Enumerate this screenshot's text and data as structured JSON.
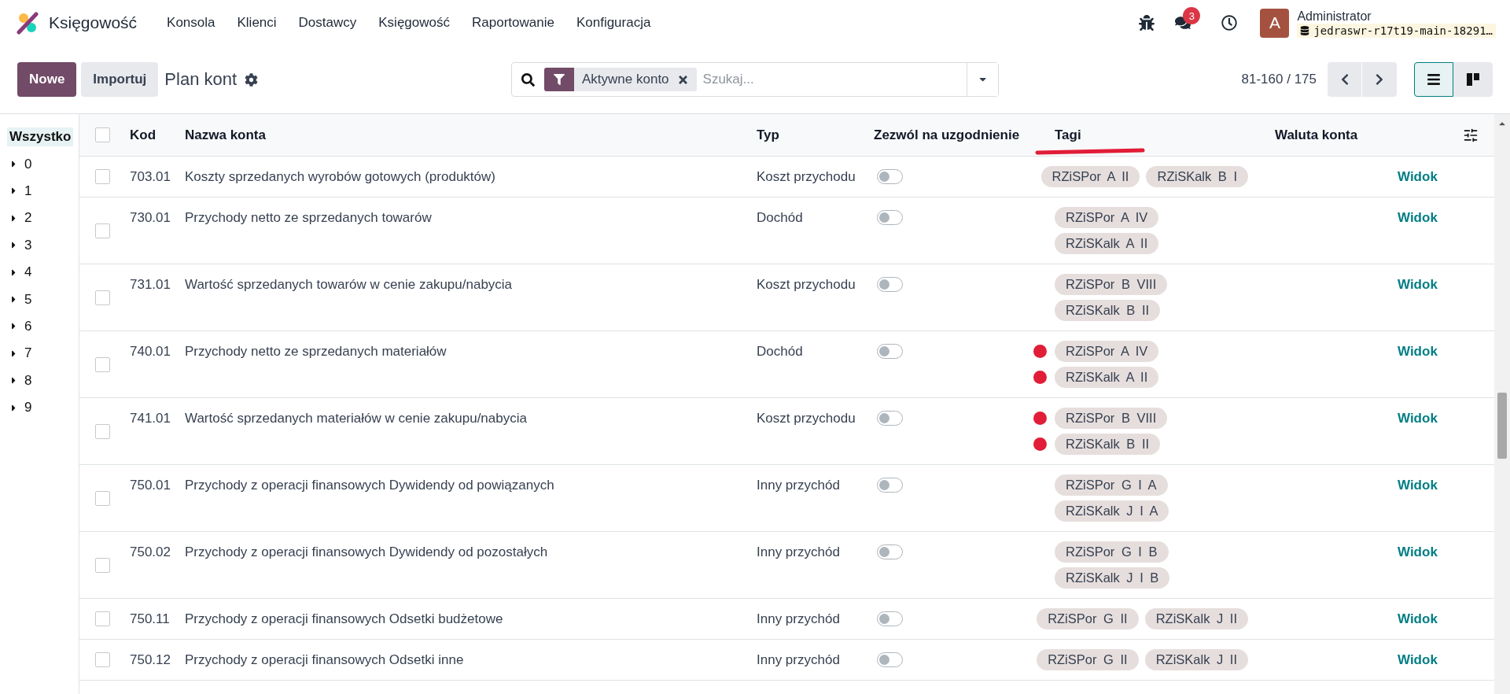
{
  "navbar": {
    "app_name": "Księgowość",
    "menu": [
      "Konsola",
      "Klienci",
      "Dostawcy",
      "Księgowość",
      "Raportowanie",
      "Konfiguracja"
    ],
    "messages_badge": "3",
    "avatar_letter": "A",
    "user_name": "Administrator",
    "database": "jedraswr-r17t19-main-18291…"
  },
  "control_panel": {
    "new_button": "Nowe",
    "import_button": "Importuj",
    "breadcrumb": "Plan kont",
    "facet": "Aktywne konto",
    "search_placeholder": "Szukaj...",
    "pager": "81-160 / 175",
    "views": [
      {
        "kind": "list",
        "selected": true
      },
      {
        "kind": "kanban",
        "selected": false
      }
    ]
  },
  "sidebar": {
    "items": [
      {
        "label": "Wszystko",
        "selected": true,
        "kind": "all"
      },
      {
        "label": "0",
        "selected": false,
        "kind": "group",
        "expanded": false
      },
      {
        "label": "1",
        "selected": false,
        "kind": "group",
        "expanded": false
      },
      {
        "label": "2",
        "selected": false,
        "kind": "group",
        "expanded": false
      },
      {
        "label": "3",
        "selected": false,
        "kind": "group",
        "expanded": false
      },
      {
        "label": "4",
        "selected": false,
        "kind": "group",
        "expanded": false
      },
      {
        "label": "5",
        "selected": false,
        "kind": "group",
        "expanded": false
      },
      {
        "label": "6",
        "selected": false,
        "kind": "group",
        "expanded": false
      },
      {
        "label": "7",
        "selected": false,
        "kind": "group",
        "expanded": false
      },
      {
        "label": "8",
        "selected": false,
        "kind": "group",
        "expanded": false
      },
      {
        "label": "9",
        "selected": false,
        "kind": "group",
        "expanded": false
      }
    ]
  },
  "table": {
    "select_all_checked": false,
    "columns": [
      {
        "label": "Kod",
        "underlined": false
      },
      {
        "label": "Nazwa konta",
        "underlined": false
      },
      {
        "label": "Typ",
        "underlined": false
      },
      {
        "label": "Zezwól na uzgodnienie",
        "underlined": false
      },
      {
        "label": "Tagi",
        "underlined": true
      },
      {
        "label": "Waluta konta",
        "underlined": false
      }
    ],
    "rows": [
      {
        "code": "703.01",
        "name": "Koszty sprzedanych wyrobów gotowych (produktów)",
        "type": "Koszt przychodu",
        "reconcile": false,
        "checked": false,
        "tag_lines": [
          [
            {
              "label": "RZiSPor A II",
              "marked": false
            },
            {
              "label": "RZiSKalk B I",
              "marked": false
            }
          ]
        ],
        "action": "Widok"
      },
      {
        "code": "730.01",
        "name": "Przychody netto ze sprzedanych towarów",
        "type": "Dochód",
        "reconcile": false,
        "checked": false,
        "tag_lines": [
          [
            {
              "label": "RZiSPor A IV",
              "marked": false
            }
          ],
          [
            {
              "label": "RZiSKalk A II",
              "marked": false
            }
          ]
        ],
        "action": "Widok"
      },
      {
        "code": "731.01",
        "name": "Wartość sprzedanych towarów w cenie zakupu/nabycia",
        "type": "Koszt przychodu",
        "reconcile": false,
        "checked": false,
        "tag_lines": [
          [
            {
              "label": "RZiSPor B VIII",
              "marked": false
            }
          ],
          [
            {
              "label": "RZiSKalk B II",
              "marked": false
            }
          ]
        ],
        "action": "Widok"
      },
      {
        "code": "740.01",
        "name": "Przychody netto ze sprzedanych materiałów",
        "type": "Dochód",
        "reconcile": false,
        "checked": false,
        "tag_lines": [
          [
            {
              "label": "RZiSPor A IV",
              "marked": true
            }
          ],
          [
            {
              "label": "RZiSKalk A II",
              "marked": true
            }
          ]
        ],
        "action": "Widok"
      },
      {
        "code": "741.01",
        "name": "Wartość sprzedanych materiałów w cenie zakupu/nabycia",
        "type": "Koszt przychodu",
        "reconcile": false,
        "checked": false,
        "tag_lines": [
          [
            {
              "label": "RZiSPor B VIII",
              "marked": true
            }
          ],
          [
            {
              "label": "RZiSKalk B II",
              "marked": true
            }
          ]
        ],
        "action": "Widok"
      },
      {
        "code": "750.01",
        "name": "Przychody z operacji finansowych Dywidendy od powiązanych",
        "type": "Inny przychód",
        "reconcile": false,
        "checked": false,
        "tag_lines": [
          [
            {
              "label": "RZiSPor G I A",
              "marked": false
            }
          ],
          [
            {
              "label": "RZiSKalk J I A",
              "marked": false
            }
          ]
        ],
        "action": "Widok"
      },
      {
        "code": "750.02",
        "name": "Przychody z operacji finansowych Dywidendy od pozostałych",
        "type": "Inny przychód",
        "reconcile": false,
        "checked": false,
        "tag_lines": [
          [
            {
              "label": "RZiSPor G I B",
              "marked": false
            }
          ],
          [
            {
              "label": "RZiSKalk J I B",
              "marked": false
            }
          ]
        ],
        "action": "Widok"
      },
      {
        "code": "750.11",
        "name": "Przychody z operacji finansowych Odsetki budżetowe",
        "type": "Inny przychód",
        "reconcile": false,
        "checked": false,
        "tag_lines": [
          [
            {
              "label": "RZiSPor G II",
              "marked": false
            },
            {
              "label": "RZiSKalk J II",
              "marked": false
            }
          ]
        ],
        "action": "Widok"
      },
      {
        "code": "750.12",
        "name": "Przychody z operacji finansowych Odsetki inne",
        "type": "Inny przychód",
        "reconcile": false,
        "checked": false,
        "tag_lines": [
          [
            {
              "label": "RZiSPor G II",
              "marked": false
            },
            {
              "label": "RZiSKalk J II",
              "marked": false
            }
          ]
        ],
        "action": "Widok"
      }
    ]
  }
}
